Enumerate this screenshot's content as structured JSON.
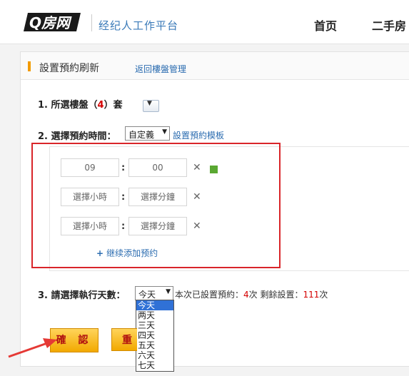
{
  "header": {
    "logo_text": "Q房网",
    "platform": "经纪人工作平台",
    "nav": [
      "首页",
      "二手房"
    ]
  },
  "panel": {
    "title": "設置預約刷新",
    "back_link": "返回樓盤管理"
  },
  "step1": {
    "label": "1. 所選樓盤（",
    "count": "4",
    "suffix": "）套"
  },
  "step2": {
    "label": "2. 選擇預約時間：",
    "mode": "自定義",
    "template_link": "設置預約模板"
  },
  "times": [
    {
      "hour": "09",
      "minute": "00"
    },
    {
      "hour": "選擇小時",
      "minute": "選擇分鐘"
    },
    {
      "hour": "選擇小時",
      "minute": "選擇分鐘"
    }
  ],
  "add_more": "继续添加预约",
  "step3": {
    "label": "3. 請選擇執行天數：",
    "selected": "今天",
    "options": [
      "今天",
      "两天",
      "三天",
      "四天",
      "五天",
      "六天",
      "七天"
    ],
    "info_prefix": "本次已設置預約：",
    "set_count": "4",
    "set_unit": "次",
    "remain_prefix": "剩餘設置：",
    "remain_count": "111",
    "remain_unit": "次"
  },
  "buttons": {
    "confirm": "確 認",
    "reset": "重"
  },
  "colors": {
    "accent_red": "#d9252a",
    "link_blue": "#2b6cb0",
    "button_gold": "#f2a900",
    "arrow": "#e53935"
  }
}
